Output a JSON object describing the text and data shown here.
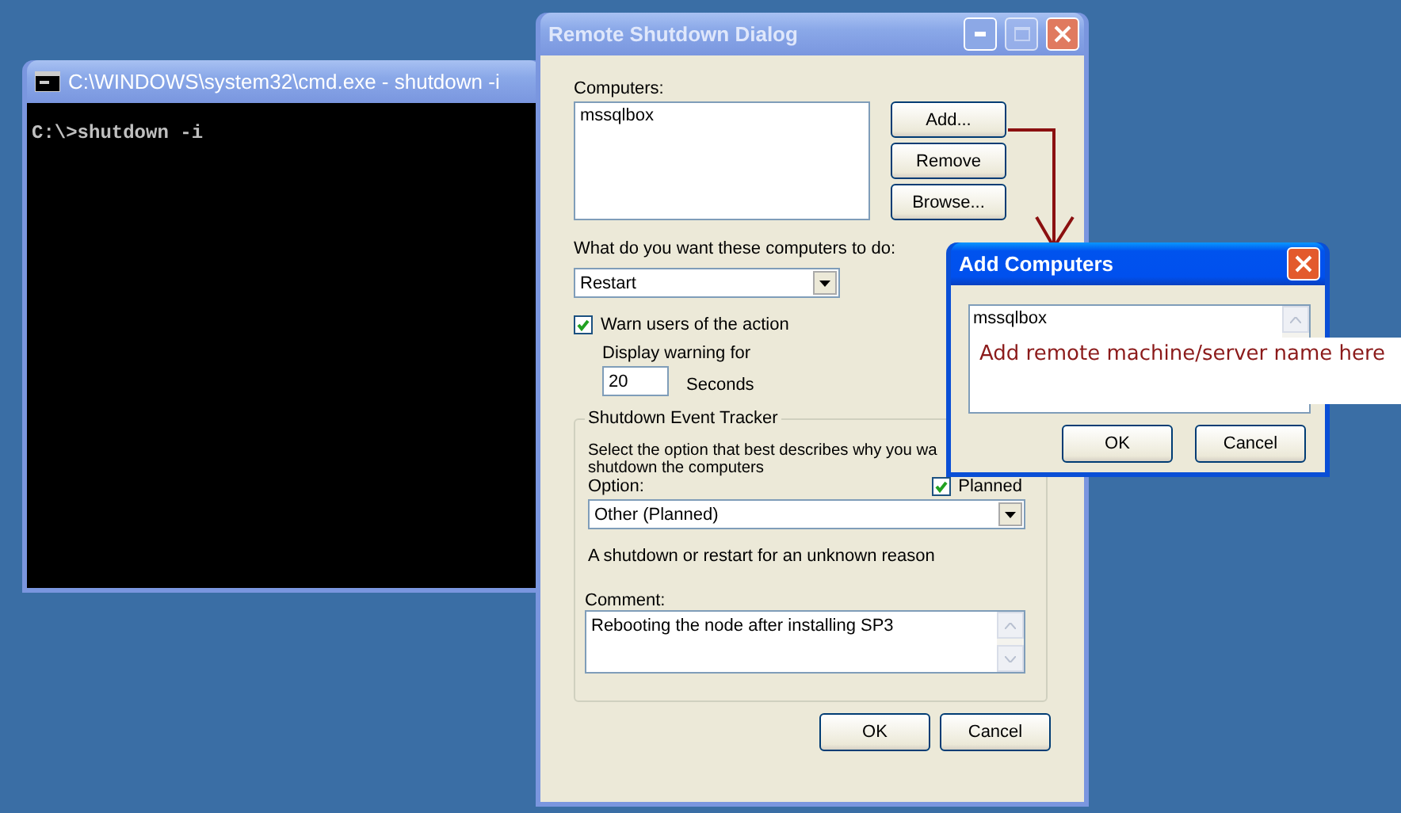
{
  "cmd_window": {
    "title": "C:\\WINDOWS\\system32\\cmd.exe - shutdown -i",
    "active": false,
    "lines": [
      "C:\\>shutdown -i"
    ]
  },
  "shutdown_dialog": {
    "title": "Remote Shutdown Dialog",
    "active": false,
    "computers_label": "Computers:",
    "computers": [
      "mssqlbox"
    ],
    "side_buttons": [
      "Add...",
      "Remove",
      "Browse..."
    ],
    "action_label": "What do you want these computers to do:",
    "action": {
      "value": "Restart"
    },
    "warn": {
      "label": "Warn users of the action",
      "checked": true
    },
    "display_warning_label": "Display warning for",
    "seconds": {
      "value": "20"
    },
    "seconds_label": "Seconds",
    "tracker": {
      "title": "Shutdown Event Tracker",
      "description": "Select the option that best describes why you wa",
      "description_2": "shutdown the computers",
      "option_label": "Option:",
      "planned": {
        "label": "Planned",
        "checked": true
      },
      "option": {
        "value": "Other (Planned)"
      },
      "reason": "A shutdown or restart for an unknown reason",
      "comment_label": "Comment:",
      "comment": {
        "value": "Rebooting the node after installing SP3"
      }
    },
    "buttons": [
      "OK",
      "Cancel"
    ]
  },
  "add_computers_dialog": {
    "title": "Add Computers",
    "active": true,
    "value": "mssqlbox",
    "buttons": [
      "OK",
      "Cancel"
    ]
  },
  "annotation": {
    "text": "Add remote machine/server name here"
  }
}
